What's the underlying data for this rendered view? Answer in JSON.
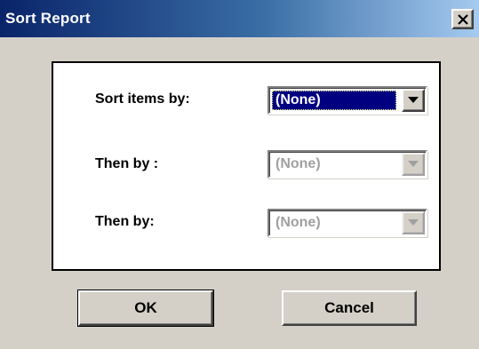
{
  "window": {
    "title": "Sort Report"
  },
  "sort_rows": [
    {
      "label": "Sort items by:",
      "value": "(None)",
      "state": "active"
    },
    {
      "label": "Then by :",
      "value": "(None)",
      "state": "disabled"
    },
    {
      "label": "Then by:",
      "value": "(None)",
      "state": "disabled"
    }
  ],
  "buttons": {
    "ok_label": "OK",
    "cancel_label": "Cancel"
  },
  "icons": {
    "close": "close-icon",
    "dropdown": "chevron-down-icon"
  },
  "colors": {
    "title_bar_start": "#0a246a",
    "title_bar_end": "#a6caf0",
    "selection": "#000080",
    "dialog_face": "#d4d0c8",
    "disabled_text": "#a0a0a0"
  }
}
